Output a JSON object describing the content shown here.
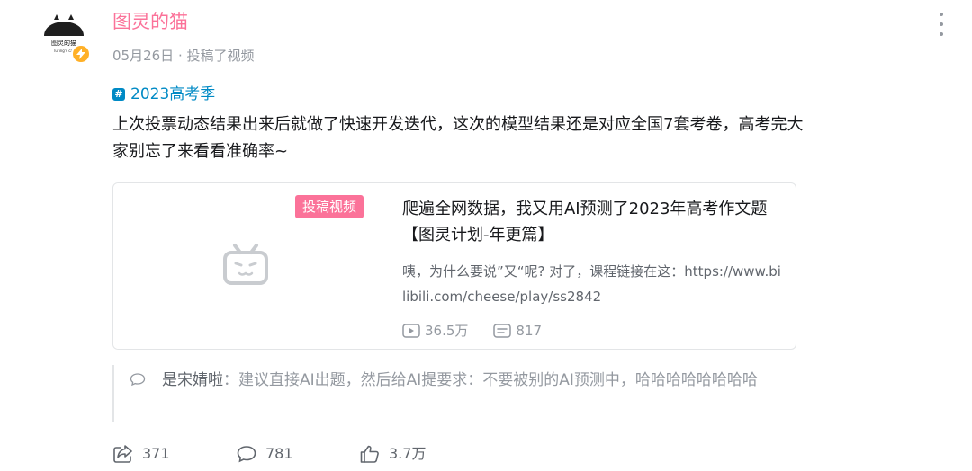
{
  "author": {
    "name": "图灵的猫",
    "avatar_caption": "图灵的猫",
    "avatar_subcaption": "Turing's cat"
  },
  "post": {
    "date": "05月26日",
    "action": "投稿了视频",
    "topic": "2023高考季",
    "content": "上次投票动态结果出来后就做了快速开发迭代，这次的模型结果还是对应全国7套考卷，高考完大家别忘了来看看准确率~"
  },
  "card": {
    "tag": "投稿视频",
    "title": "爬遍全网数据，我又用AI预测了2023年高考作文题【图灵计划-年更篇】",
    "description": "咦，为什么要说”又“呢? 对了，课程链接在这：https://www.bilibili.com/cheese/play/ss2842",
    "views": "36.5万",
    "danmaku": "817"
  },
  "reply": {
    "username": "是宋婧啦",
    "separator": "：",
    "text": "建议直接AI出题，然后给AI提要求：不要被别的AI预测中，哈哈哈哈哈哈哈哈"
  },
  "actions": {
    "share": "371",
    "comment": "781",
    "like": "3.7万"
  },
  "colors": {
    "accent_pink": "#fb7299",
    "topic_blue": "#008ac5",
    "badge_yellow": "#ffb027"
  }
}
